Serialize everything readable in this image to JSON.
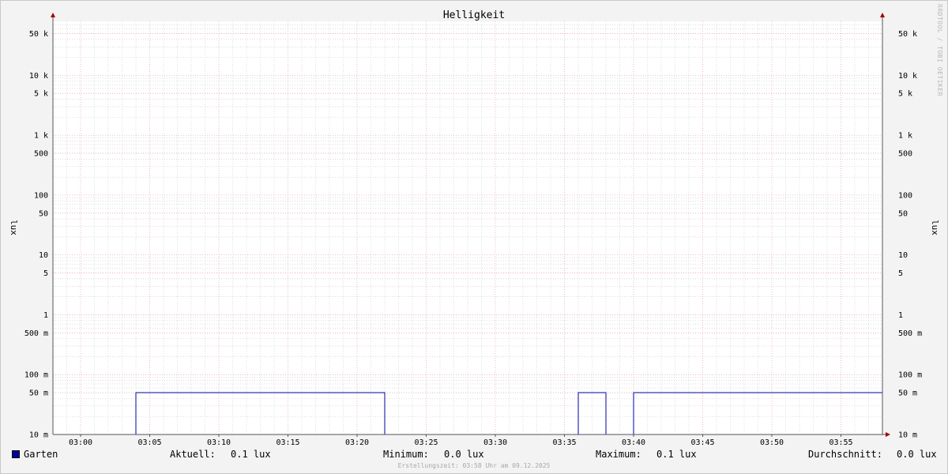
{
  "chart_data": {
    "type": "line",
    "title": "Helligkeit",
    "ylabel_left": "lux",
    "ylabel_right": "lux",
    "yscale": "log",
    "ylim": [
      0.01,
      80000
    ],
    "xlim": [
      "02:58",
      "03:58"
    ],
    "x_ticks": [
      "03:00",
      "03:05",
      "03:10",
      "03:15",
      "03:20",
      "03:25",
      "03:30",
      "03:35",
      "03:40",
      "03:45",
      "03:50",
      "03:55"
    ],
    "y_ticks": [
      {
        "value": 50000,
        "label": "50 k"
      },
      {
        "value": 10000,
        "label": "10 k"
      },
      {
        "value": 5000,
        "label": "5 k"
      },
      {
        "value": 1000,
        "label": "1 k"
      },
      {
        "value": 500,
        "label": "500"
      },
      {
        "value": 100,
        "label": "100"
      },
      {
        "value": 50,
        "label": "50"
      },
      {
        "value": 10,
        "label": "10"
      },
      {
        "value": 5,
        "label": "5"
      },
      {
        "value": 1,
        "label": "1"
      },
      {
        "value": 0.5,
        "label": "500 m"
      },
      {
        "value": 0.1,
        "label": "100 m"
      },
      {
        "value": 0.05,
        "label": "50 m"
      },
      {
        "value": 0.01,
        "label": "10 m"
      }
    ],
    "grid": true,
    "series": [
      {
        "name": "Garten",
        "color": "#0000a0",
        "step": true,
        "points": [
          {
            "x": "02:58",
            "y": 0.01
          },
          {
            "x": "03:04",
            "y": 0.05
          },
          {
            "x": "03:22",
            "y": 0.01
          },
          {
            "x": "03:36",
            "y": 0.05
          },
          {
            "x": "03:38",
            "y": 0.01
          },
          {
            "x": "03:40",
            "y": 0.05
          },
          {
            "x": "03:58",
            "y": 0.05
          }
        ]
      }
    ]
  },
  "legend": {
    "series_name": "Garten",
    "aktuell_label": "Aktuell:",
    "aktuell_value": "0.1 lux",
    "minimum_label": "Minimum:",
    "minimum_value": "0.0 lux",
    "maximum_label": "Maximum:",
    "maximum_value": "0.1 lux",
    "durchschnitt_label": "Durchschnitt:",
    "durchschnitt_value": "0.0 lux"
  },
  "footer": "Erstellungszeit: 03:58 Uhr am 09.12.2025",
  "watermark": "RRDTOOL / TOBI OETIKER",
  "colors": {
    "line": "#0000a0",
    "major_grid": "#e8a0a0",
    "minor_grid": "#c8c8c8",
    "axis": "#555555",
    "arrow": "#a00000"
  }
}
